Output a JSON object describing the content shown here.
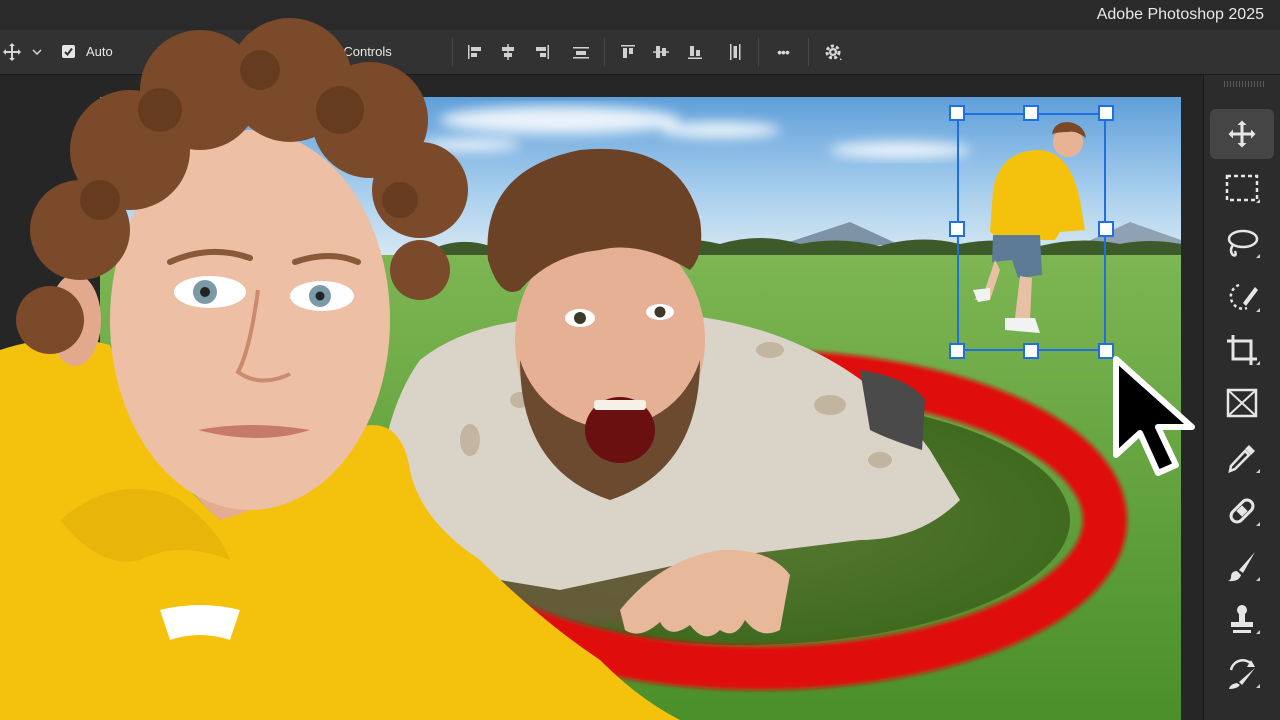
{
  "app": {
    "title": "Adobe Photoshop 2025"
  },
  "options_bar": {
    "auto_select_label": "Auto",
    "auto_select_checked": true,
    "transform_controls_label": "nsform Controls",
    "more_label": "•••"
  },
  "toolbar": {
    "tools": [
      {
        "name": "move-tool",
        "icon": "move-icon",
        "active": true
      },
      {
        "name": "marquee-tool",
        "icon": "rectangular-marquee-icon"
      },
      {
        "name": "lasso-tool",
        "icon": "lasso-icon"
      },
      {
        "name": "object-selection-tool",
        "icon": "object-selection-icon"
      },
      {
        "name": "crop-tool",
        "icon": "crop-icon"
      },
      {
        "name": "frame-tool",
        "icon": "frame-icon"
      },
      {
        "name": "eyedropper-tool",
        "icon": "eyedropper-icon"
      },
      {
        "name": "healing-brush-tool",
        "icon": "healing-brush-icon"
      },
      {
        "name": "brush-tool",
        "icon": "brush-icon"
      },
      {
        "name": "clone-stamp-tool",
        "icon": "clone-stamp-icon"
      },
      {
        "name": "history-brush-tool",
        "icon": "history-brush-icon"
      }
    ]
  },
  "colors": {
    "selection": "#1f6fe0",
    "accent_red": "#e01010",
    "hoodie_yellow": "#f4c20d",
    "grass": "#5ea033",
    "sky": "#8fc3ea"
  }
}
